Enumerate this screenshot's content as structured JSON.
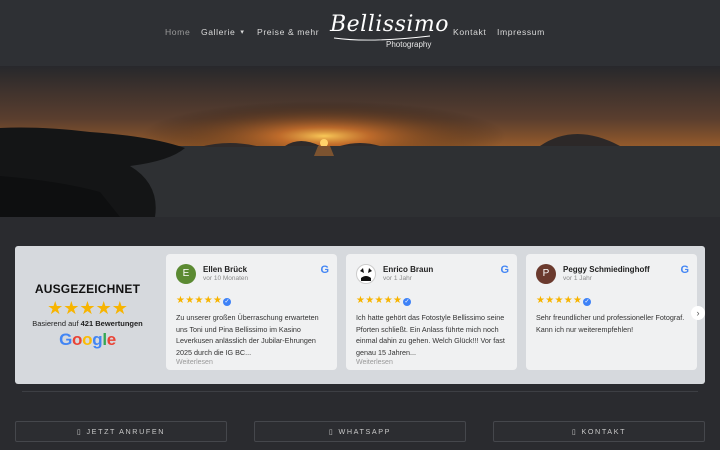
{
  "nav": {
    "items": [
      {
        "label": "Home"
      },
      {
        "label": "Gallerie"
      },
      {
        "label": "Preise & mehr"
      },
      {
        "label": "Kontakt"
      },
      {
        "label": "Impressum"
      }
    ],
    "logo": {
      "script": "Bellissimo",
      "sub": "Photography"
    }
  },
  "reviews": {
    "summary": {
      "title": "AUSGEZEICHNET",
      "stars": "★★★★★",
      "based_prefix": "Basierend auf",
      "based_count": "421 Bewertungen",
      "brand": "Google"
    },
    "cards": [
      {
        "initial": "E",
        "avatar_color": "#5b8a32",
        "name": "Ellen Brück",
        "time": "vor 10 Monaten",
        "stars": "★★★★★",
        "text": "Zu unserer großen Überraschung erwarteten uns Toni und Pina Bellissimo im Kasino Leverkusen anlässlich der Jubilar-Ehrungen 2025 durch die IG BC...",
        "more": "Weiterlesen"
      },
      {
        "initial": "",
        "avatar_color": "#ffffff",
        "name": "Enrico Braun",
        "time": "vor 1 Jahr",
        "stars": "★★★★★",
        "text": "Ich hatte gehört das Fotostyle Bellissimo seine Pforten schließt. Ein Anlass führte mich noch einmal dahin zu gehen. Welch Glück!!! Vor fast genau 15 Jahren...",
        "more": "Weiterlesen"
      },
      {
        "initial": "P",
        "avatar_color": "#6b3a2e",
        "name": "Peggy Schmiedinghoff",
        "time": "vor 1 Jahr",
        "stars": "★★★★★",
        "text": "Sehr freundlicher und professioneller Fotograf. Kann ich nur weiterempfehlen!",
        "more": ""
      }
    ],
    "google_icon": "G",
    "next_arrow": "›"
  },
  "buttons": [
    {
      "icon": "phone-icon",
      "glyph": "▯",
      "label": "JETZT ANRUFEN"
    },
    {
      "icon": "whatsapp-icon",
      "glyph": "▯",
      "label": "WHATSAPP"
    },
    {
      "icon": "mail-icon",
      "glyph": "▯",
      "label": "KONTAKT"
    }
  ],
  "colors": {
    "background": "#2a2b2f",
    "nav": "#2e3034",
    "star": "#f7b400",
    "google_blue": "#4285f4"
  }
}
